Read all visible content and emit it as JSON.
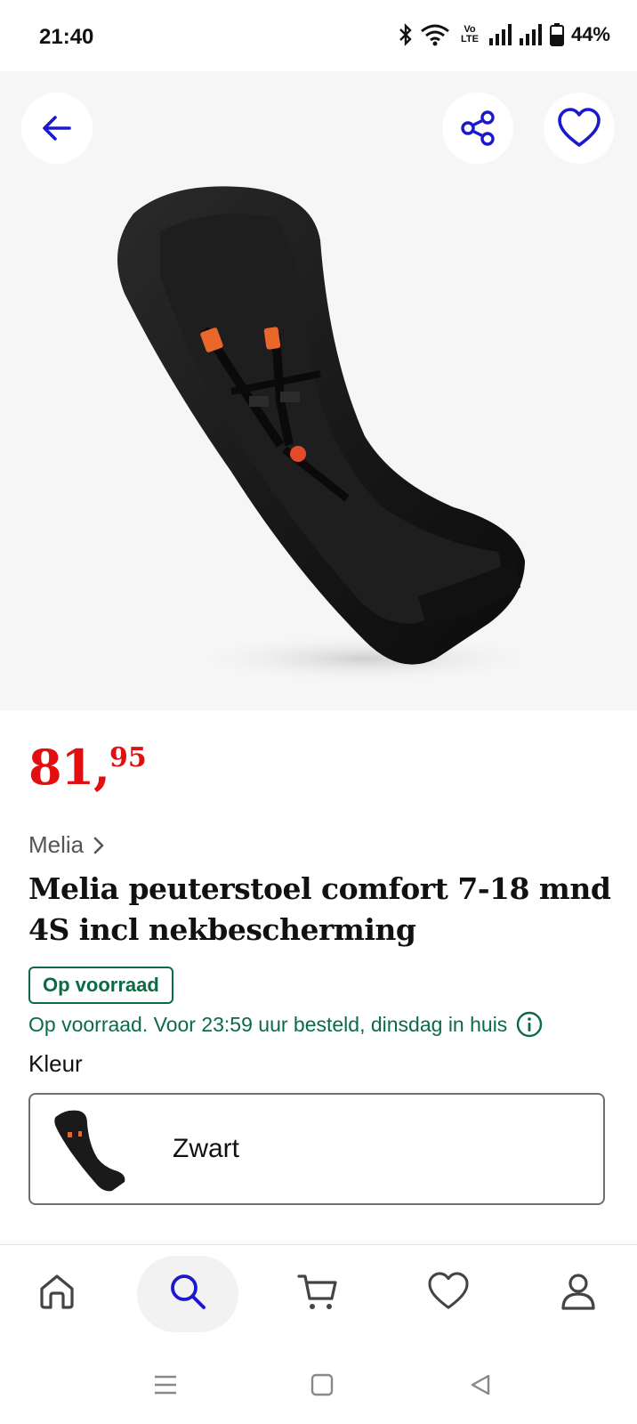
{
  "status_bar": {
    "time": "21:40",
    "network_label": "Vo LTE",
    "battery": "44%"
  },
  "product": {
    "price_main": "81,",
    "price_cents": "95",
    "price_color": "#e10f0f",
    "brand": "Melia",
    "title": "Melia peuterstoel comfort 7-18 mnd 4S incl nekbescherming",
    "stock_badge": "Op voorraad",
    "stock_message": "Op voorraad. Voor 23:59 uur besteld, dinsdag in huis",
    "stock_color": "#0a6b45",
    "color_label": "Kleur",
    "color_value": "Zwart"
  },
  "header_actions": {
    "icons": [
      "back-arrow-icon",
      "share-icon",
      "heart-icon"
    ],
    "accent": "#1a1acc"
  },
  "bottom_nav": {
    "items": [
      "home",
      "search",
      "cart",
      "favorites",
      "account"
    ],
    "active": "search"
  },
  "system_nav": {
    "buttons": [
      "recents",
      "home",
      "back"
    ]
  }
}
